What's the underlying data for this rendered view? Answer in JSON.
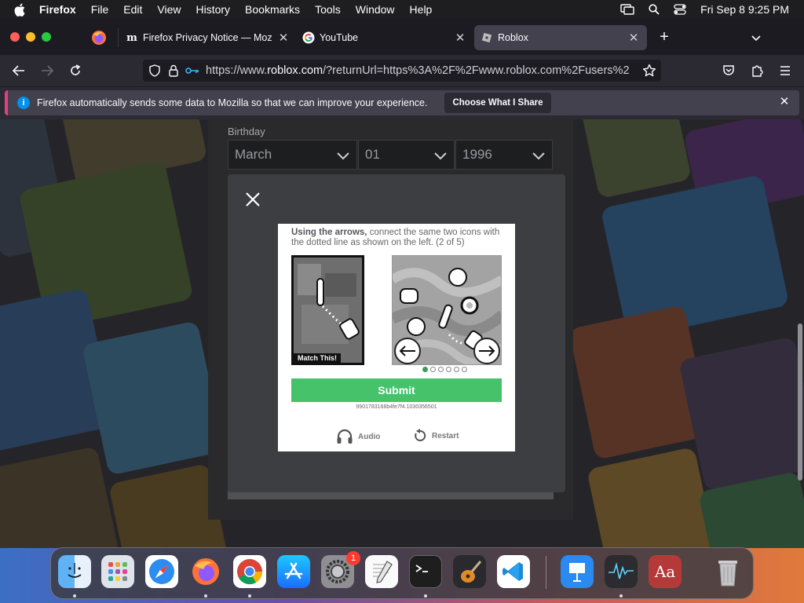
{
  "menubar": {
    "app_name": "Firefox",
    "items": [
      "File",
      "Edit",
      "View",
      "History",
      "Bookmarks",
      "Tools",
      "Window",
      "Help"
    ],
    "clock": "Fri Sep 8  9:25 PM"
  },
  "tabs": [
    {
      "title": "Firefox Privacy Notice — Mozilla",
      "icon": "mozilla-icon"
    },
    {
      "title": "YouTube",
      "icon": "google-icon"
    },
    {
      "title": "Roblox",
      "icon": "roblox-icon",
      "active": true
    }
  ],
  "navbar": {
    "url_prefix": "https://www.",
    "url_host": "roblox.com",
    "url_rest": "/?returnUrl=https%3A%2F%2Fwww.roblox.com%2Fusers%2"
  },
  "notification": {
    "message": "Firefox automatically sends some data to Mozilla so that we can improve your experience.",
    "button": "Choose What I Share"
  },
  "signup": {
    "birthday_label": "Birthday",
    "month": "March",
    "day": "01",
    "year": "1996"
  },
  "captcha": {
    "instruction_bold": "Using the arrows,",
    "instruction_rest": " connect the same two icons with the dotted line as shown on the left. (2 of 5)",
    "match_label": "Match This!",
    "submit_label": "Submit",
    "session_id": "9901783168b4fe7f4.1030356501",
    "audio_label": "Audio",
    "restart_label": "Restart",
    "progress_current": 1,
    "progress_total": 6
  },
  "dock": {
    "apps": [
      "Finder",
      "Launchpad",
      "Safari",
      "Firefox",
      "Chrome",
      "App Store",
      "System Settings",
      "TextEdit",
      "Terminal",
      "GarageBand",
      "VS Code",
      "Keynote",
      "Activity Monitor",
      "Dictionary",
      "Trash"
    ],
    "settings_badge": "1"
  },
  "colors": {
    "accent_pink": "#e53f80",
    "info_blue": "#0090ed",
    "submit_green": "#45c26a"
  }
}
